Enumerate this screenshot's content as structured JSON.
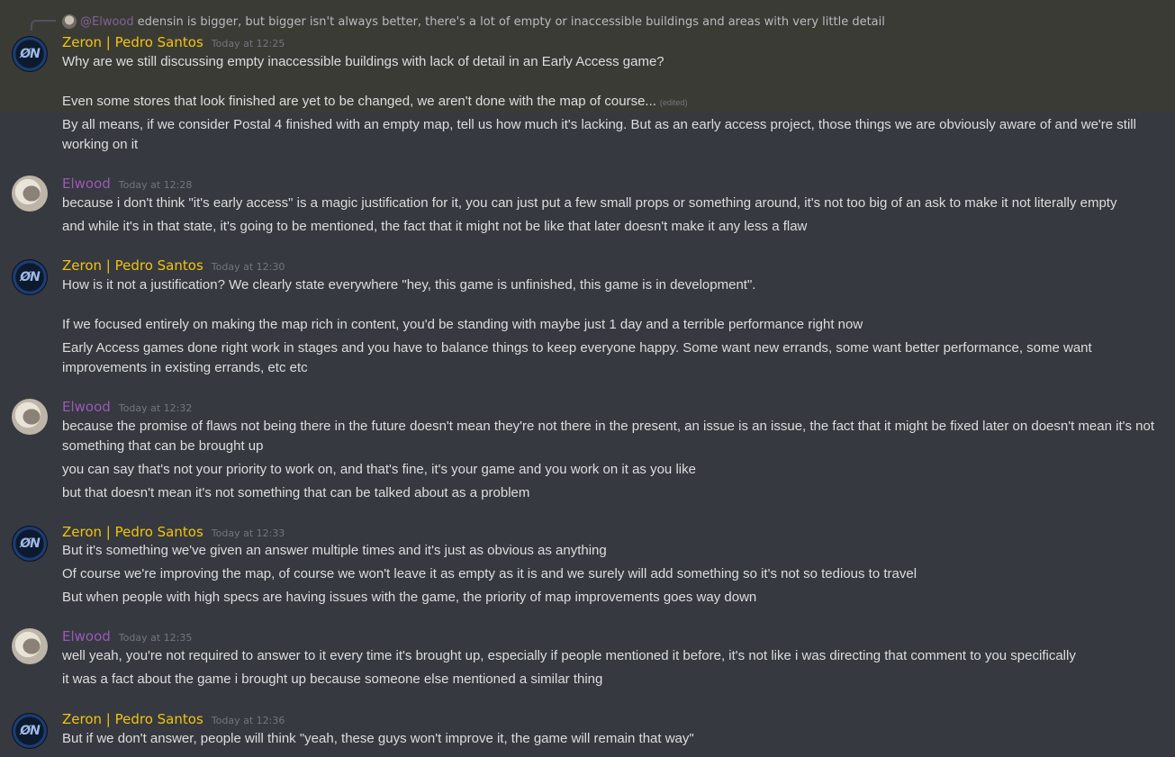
{
  "reply": {
    "mention": "@Elwood",
    "text": "edensin is bigger, but bigger isn't always better, there's a lot of empty or inaccessible buildings and areas with very little detail"
  },
  "messages": [
    {
      "author": "Zeron | Pedro Santos",
      "author_type": "zeron",
      "timestamp": "Today at 12:25",
      "lines": [
        "Why are we still discussing empty inaccessible buildings with lack of detail in an Early Access game?",
        "Even some stores that look finished are yet to be changed, we aren't done with the map of course...",
        "By all means, if we consider Postal 4 finished with an empty map, tell us how much it's lacking. But as an early access project, those things we are obviously aware of and we're still working on it"
      ],
      "edited_label": "(edited)"
    },
    {
      "author": "Elwood",
      "author_type": "elwood",
      "timestamp": "Today at 12:28",
      "lines": [
        "because i don't think \"it's early access\" is a magic justification for it, you can just put a few small props or something around, it's not too big of an ask to make it not literally empty",
        "and while it's in that state, it's going to be mentioned, the fact that it might not be like that later doesn't make it any less a flaw"
      ]
    },
    {
      "author": "Zeron | Pedro Santos",
      "author_type": "zeron",
      "timestamp": "Today at 12:30",
      "lines": [
        "How is it not a justification? We clearly state everywhere \"hey, this game is unfinished, this game is in development\".",
        "If we focused entirely on making the map rich in content, you'd be standing with maybe just 1 day and a terrible performance right now",
        "Early Access games done right work in stages and you have to balance things to keep everyone happy. Some want new errands, some want better performance, some want improvements in existing errands, etc etc"
      ]
    },
    {
      "author": "Elwood",
      "author_type": "elwood",
      "timestamp": "Today at 12:32",
      "lines": [
        "because the promise of flaws not being there in the future doesn't mean they're not there in the present, an issue is an issue, the fact that it might be fixed later on doesn't mean it's not something that can be brought up",
        "you can say that's not your priority to work on, and that's fine, it's your game and you work on it as you like",
        "but that doesn't mean it's not something that can be talked about as a problem"
      ]
    },
    {
      "author": "Zeron | Pedro Santos",
      "author_type": "zeron",
      "timestamp": "Today at 12:33",
      "lines": [
        "But it's something we've given an answer multiple times and it's just as obvious as anything",
        "Of course we're improving the map, of course we won't leave it as empty as it is and we surely will add something so it's not so tedious to travel",
        "But when people with high specs are having issues with the game, the priority of map improvements goes way down"
      ]
    },
    {
      "author": "Elwood",
      "author_type": "elwood",
      "timestamp": "Today at 12:35",
      "lines": [
        "well yeah, you're not required to answer to it every time it's brought up, especially if people mentioned it before, it's not like i was directing that comment to you specifically",
        "it was a fact about the game i brought up because someone else mentioned a similar thing"
      ]
    },
    {
      "author": "Zeron | Pedro Santos",
      "author_type": "zeron",
      "timestamp": "Today at 12:36",
      "lines": [
        "But if we don't answer, people will think \"yeah, these guys won't improve it, the game will remain that way\""
      ]
    }
  ]
}
